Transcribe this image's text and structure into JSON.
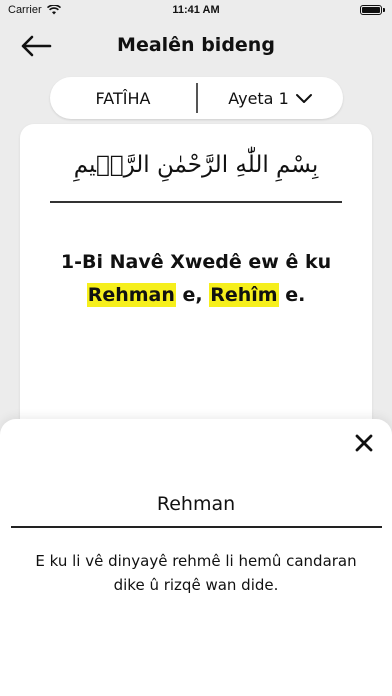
{
  "status_bar": {
    "carrier": "Carrier",
    "time": "11:41 AM",
    "icons": [
      "wifi-icon",
      "battery-icon"
    ]
  },
  "nav": {
    "back_icon": "arrow-left-icon",
    "title": "Mealên bideng"
  },
  "selector": {
    "surah": "FATÎHA",
    "ayah": "Ayeta 1",
    "ayah_icon": "chevron-down-icon"
  },
  "verse": {
    "arabic": "بِسْمِ اللّٰهِ الرَّحْمٰنِ الرَّح۪يمِ",
    "translation_parts": {
      "p1": "1-Bi Navê Xwedê ew ê ku ",
      "term1": "Rehman",
      "p2": " e, ",
      "term2": "Rehîm",
      "p3": " e."
    },
    "highlight_color": "#f6ef1c"
  },
  "sheet": {
    "close_icon": "close-icon",
    "term": "Rehman",
    "definition": "E ku li vê dinyayê rehmê li hemû candaran dike û rizqê wan dide."
  }
}
